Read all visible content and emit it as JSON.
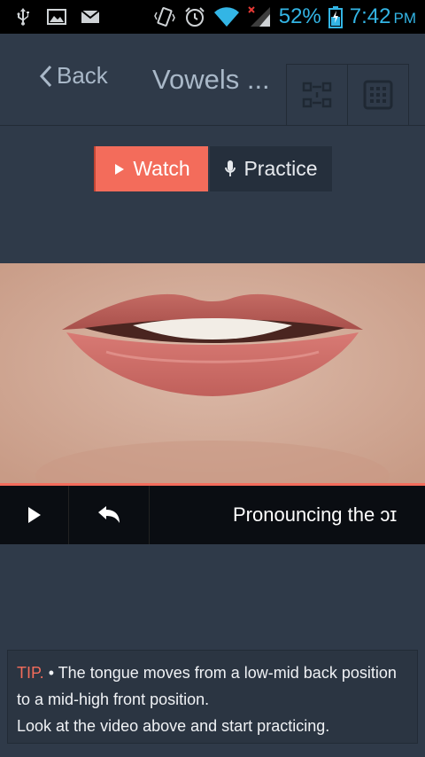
{
  "status_bar": {
    "battery_percent": "52%",
    "time": "7:42",
    "ampm": "PM",
    "icons": [
      "usb-icon",
      "image-icon",
      "mail-icon",
      "vibrate-icon",
      "alarm-icon",
      "wifi-icon",
      "signal-icon",
      "battery-icon"
    ]
  },
  "header": {
    "back_label": "Back",
    "title": "Vowels ..."
  },
  "mode_toggle": {
    "watch_label": "Watch",
    "practice_label": "Practice",
    "selected": "Watch"
  },
  "video": {
    "caption": "Pronouncing the ɔɪ",
    "progress": 1.0
  },
  "tip": {
    "label": "TIP.",
    "text": "• The tongue moves from a low-mid back position to a mid-high front position.",
    "text2": "Look at the video above and start practicing."
  },
  "colors": {
    "accent": "#f36c5b",
    "background": "#2f3a49",
    "status_blue": "#33b5e5"
  }
}
